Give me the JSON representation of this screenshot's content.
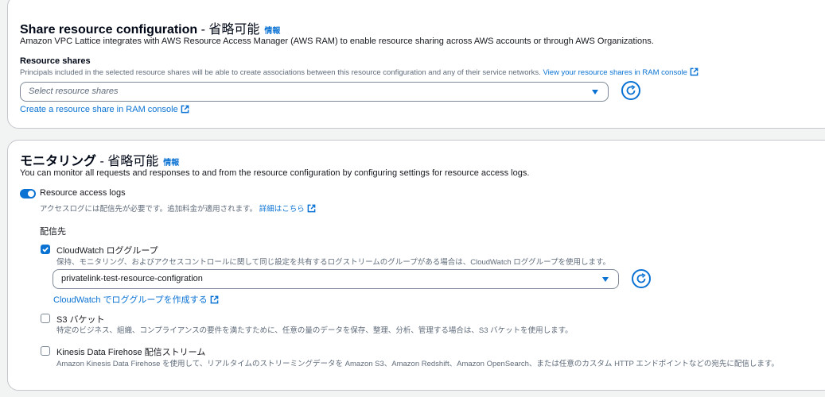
{
  "share": {
    "title": "Share resource configuration",
    "title_optional": " - 省略可能",
    "info": "情報",
    "description": "Amazon VPC Lattice integrates with AWS Resource Access Manager (AWS RAM) to enable resource sharing across AWS accounts or through AWS Organizations.",
    "resource_shares_label": "Resource shares",
    "resource_shares_hint": "Principals included in the selected resource shares will be able to create associations between this resource configuration and any of their service networks.",
    "view_shares_link": "View your resource shares in RAM console",
    "select_placeholder": "Select resource shares",
    "create_link": "Create a resource share in RAM console"
  },
  "monitoring": {
    "title": "モニタリング",
    "title_optional": " - 省略可能",
    "info": "情報",
    "description": "You can monitor all requests and responses to and from the resource configuration by configuring settings for resource access logs.",
    "toggle_label": "Resource access logs",
    "toggle_on": true,
    "toggle_hint": "アクセスログには配信先が必要です。追加料金が適用されます。",
    "learn_more_link": "詳細はこちら",
    "destination_label": "配信先",
    "cloudwatch": {
      "label": "CloudWatch ロググループ",
      "checked": true,
      "hint": "保持、モニタリング、およびアクセスコントロールに関して同じ設定を共有するログストリームのグループがある場合は、CloudWatch ロググループを使用します。",
      "selected_value": "privatelink-test-resource-configration",
      "create_link": "CloudWatch でロググループを作成する"
    },
    "s3": {
      "label": "S3 バケット",
      "checked": false,
      "hint": "特定のビジネス、組織、コンプライアンスの要件を満たすために、任意の量のデータを保存、整理、分析、管理する場合は、S3 バケットを使用します。"
    },
    "firehose": {
      "label": "Kinesis Data Firehose 配信ストリーム",
      "checked": false,
      "hint": "Amazon Kinesis Data Firehose を使用して、リアルタイムのストリーミングデータを Amazon S3、Amazon Redshift、Amazon OpenSearch、または任意のカスタム HTTP エンドポイントなどの宛先に配信します。"
    }
  },
  "colors": {
    "link": "#0972d3",
    "border": "#7d8998",
    "text": "#16191f",
    "muted": "#5f6b7a"
  },
  "icons": {
    "external": "external-link-icon",
    "refresh": "refresh-icon",
    "caret": "caret-down-icon",
    "check": "check-icon"
  }
}
